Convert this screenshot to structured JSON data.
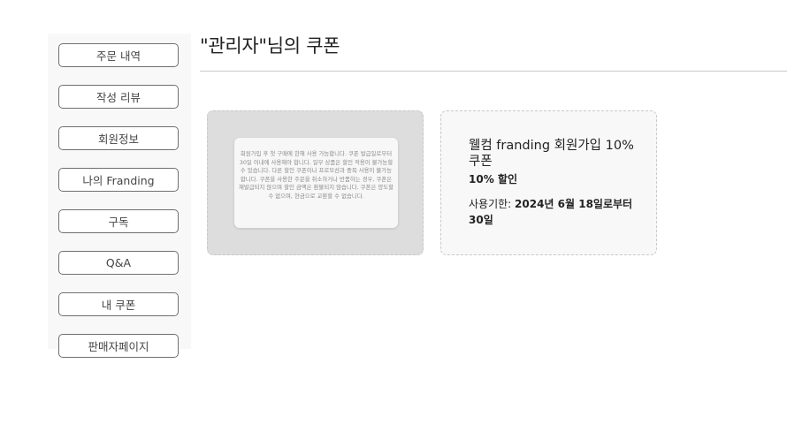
{
  "sidebar": {
    "items": [
      {
        "label": "주문 내역"
      },
      {
        "label": "작성 리뷰"
      },
      {
        "label": "회원정보"
      },
      {
        "label": "나의 Franding"
      },
      {
        "label": "구독"
      },
      {
        "label": "Q&A"
      },
      {
        "label": "내 쿠폰"
      },
      {
        "label": "판매자페이지"
      }
    ]
  },
  "page": {
    "title": "\"관리자\"님의 쿠폰"
  },
  "coupon": {
    "notice": "회원가입 후 첫 구매에 한해 사용 가능합니다. 쿠폰 발급일로부터 30일 이내에 사용해야 합니다. 일부 상품은 할인 적용이 불가능할 수 있습니다. 다른 할인 쿠폰이나 프로모션과 중복 사용이 불가능합니다. 쿠폰을 사용한 주문을 취소하거나 반품하는 경우, 쿠폰은 재발급되지 않으며 할인 금액은 환불되지 않습니다. 쿠폰은 양도할 수 없으며, 현금으로 교환할 수 없습니다.",
    "name": "웰컴 franding 회원가입 10% 쿠폰",
    "discount": "10% 할인",
    "expiry_label": "사용기한: ",
    "expiry_value": "2024년 6월 18일로부터 30일"
  }
}
